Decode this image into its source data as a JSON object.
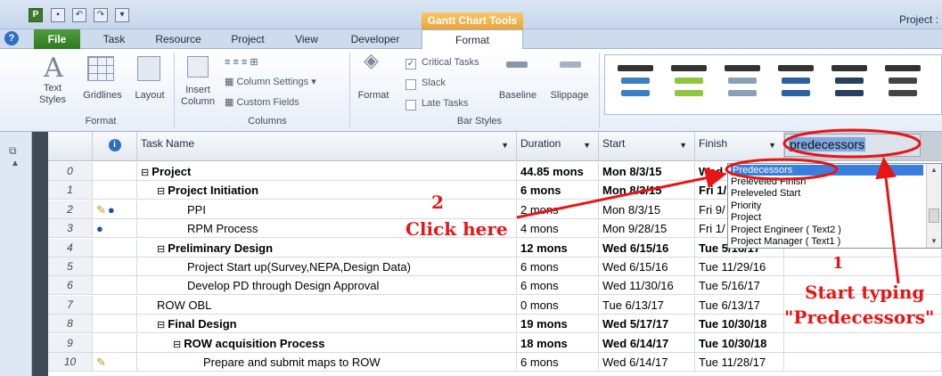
{
  "window": {
    "title": "Project :",
    "context_tab": "Gantt Chart Tools"
  },
  "quick_access": {
    "app": "P",
    "save": "▪",
    "undo": "↶",
    "redo": "↷",
    "customize": "▾"
  },
  "ribbon_tabs": [
    "File",
    "Task",
    "Resource",
    "Project",
    "View",
    "Developer",
    "Format"
  ],
  "help": "?",
  "groups": {
    "format": {
      "label": "Format",
      "text_styles": "Text Styles",
      "gridlines": "Gridlines",
      "layout": "Layout"
    },
    "columns": {
      "label": "Columns",
      "insert_column": "Insert Column",
      "column_settings": "Column Settings",
      "custom_fields": "Custom Fields"
    },
    "bar_styles": {
      "label": "Bar Styles",
      "format": "Format",
      "critical_tasks": "Critical Tasks",
      "slack": "Slack",
      "late_tasks": "Late Tasks",
      "baseline": "Baseline",
      "slippage": "Slippage"
    }
  },
  "colors": {
    "gallery": [
      "#3b7fc4",
      "#8fc640",
      "#8aa0b8",
      "#2d5fa3",
      "#28405f"
    ],
    "annotation": "#e81515"
  },
  "table": {
    "headers": {
      "task_name": "Task Name",
      "duration": "Duration",
      "start": "Start",
      "finish": "Finish"
    },
    "rows": [
      {
        "id": "0",
        "name": "Project",
        "duration": "44.85 mons",
        "start": "Mon 8/3/15",
        "finish": "Wed",
        "indent": 0,
        "bold": true,
        "collapse": true,
        "icons": ""
      },
      {
        "id": "1",
        "name": "Project Initiation",
        "duration": "6 mons",
        "start": "Mon 8/3/15",
        "finish": "Fri 1/",
        "indent": 1,
        "bold": true,
        "collapse": true,
        "icons": ""
      },
      {
        "id": "2",
        "name": "PPI",
        "duration": "2 mons",
        "start": "Mon 8/3/15",
        "finish": "Fri 9/",
        "indent": 2,
        "bold": false,
        "collapse": false,
        "icons": "note,globe"
      },
      {
        "id": "3",
        "name": "RPM Process",
        "duration": "4 mons",
        "start": "Mon 9/28/15",
        "finish": "Fri 1/",
        "indent": 2,
        "bold": false,
        "collapse": false,
        "icons": "globe"
      },
      {
        "id": "4",
        "name": "Preliminary Design",
        "duration": "12 mons",
        "start": "Wed 6/15/16",
        "finish": "Tue 5/16/17",
        "indent": 1,
        "bold": true,
        "collapse": true,
        "icons": ""
      },
      {
        "id": "5",
        "name": "Project Start up(Survey,NEPA,Design Data)",
        "duration": "6 mons",
        "start": "Wed 6/15/16",
        "finish": "Tue 11/29/16",
        "indent": 2,
        "bold": false,
        "collapse": false,
        "icons": ""
      },
      {
        "id": "6",
        "name": "Develop PD through Design Approval",
        "duration": "6 mons",
        "start": "Wed 11/30/16",
        "finish": "Tue 5/16/17",
        "indent": 2,
        "bold": false,
        "collapse": false,
        "icons": ""
      },
      {
        "id": "7",
        "name": "ROW OBL",
        "duration": "0 mons",
        "start": "Tue 6/13/17",
        "finish": "Tue 6/13/17",
        "indent": 1,
        "bold": false,
        "collapse": false,
        "icons": ""
      },
      {
        "id": "8",
        "name": "Final Design",
        "duration": "19 mons",
        "start": "Wed 5/17/17",
        "finish": "Tue 10/30/18",
        "indent": 1,
        "bold": true,
        "collapse": true,
        "icons": ""
      },
      {
        "id": "9",
        "name": "ROW acquisition Process",
        "duration": "18 mons",
        "start": "Wed 6/14/17",
        "finish": "Tue 10/30/18",
        "indent": 2,
        "bold": true,
        "collapse": true,
        "icons": ""
      },
      {
        "id": "10",
        "name": "Prepare and submit maps to ROW",
        "duration": "6 mons",
        "start": "Wed 6/14/17",
        "finish": "Tue 11/28/17",
        "indent": 3,
        "bold": false,
        "collapse": false,
        "icons": "note"
      }
    ]
  },
  "search": {
    "value": "predecessors"
  },
  "dropdown": {
    "options": [
      "Predecessors",
      "Preleveled Finish",
      "Preleveled Start",
      "Priority",
      "Project",
      "Project Engineer ( Text2 )",
      "Project Manager ( Text1 )"
    ]
  },
  "annotations": {
    "step1_number": "1",
    "step1_text": "Start typing",
    "step1_quote": "\"Predecessors\"",
    "step2_number": "2",
    "step2_text": "Click here"
  }
}
